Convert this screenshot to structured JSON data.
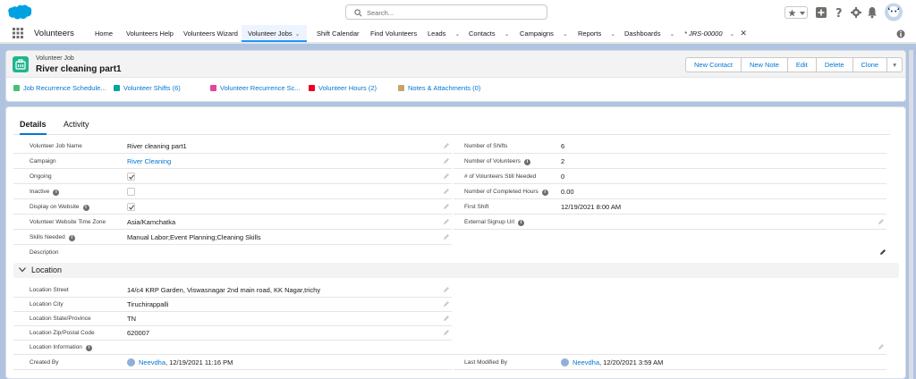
{
  "global": {
    "search_placeholder": "Search...",
    "brand_color": "#00a1e0"
  },
  "nav": {
    "app_name": "Volunteers",
    "items": [
      {
        "label": "Home"
      },
      {
        "label": "Volunteers Help"
      },
      {
        "label": "Volunteers Wizard"
      },
      {
        "label": "Volunteer Jobs"
      },
      {
        "label": "Shift Calendar"
      },
      {
        "label": "Find Volunteers"
      },
      {
        "label": "Leads"
      },
      {
        "label": "Contacts"
      },
      {
        "label": "Campaigns"
      },
      {
        "label": "Reports"
      },
      {
        "label": "Dashboards"
      },
      {
        "label": "* JRS-00000"
      }
    ]
  },
  "record": {
    "object_label": "Volunteer Job",
    "title": "River cleaning part1",
    "buttons": [
      "New Contact",
      "New Note",
      "Edit",
      "Delete",
      "Clone"
    ]
  },
  "related": [
    {
      "label": "Job Recurrence Schedule...",
      "color": "#4bc076"
    },
    {
      "label": "Volunteer Shifts (6)",
      "color": "#06a59a"
    },
    {
      "label": "Volunteer Recurrence Sc...",
      "color": "#e4449e"
    },
    {
      "label": "Volunteer Hours (2)",
      "color": "#ea001e"
    },
    {
      "label": "Notes & Attachments (0)",
      "color": "#c9a36b"
    }
  ],
  "tabs": [
    "Details",
    "Activity"
  ],
  "fields_left": [
    {
      "label": "Volunteer Job Name",
      "value": "River cleaning part1"
    },
    {
      "label": "Campaign",
      "value": "River Cleaning"
    },
    {
      "label": "Ongoing",
      "checked": true
    },
    {
      "label": "Inactive",
      "checked": false
    },
    {
      "label": "Display on Website",
      "checked": true
    },
    {
      "label": "Volunteer Website Time Zone",
      "value": "Asia/Kamchatka"
    },
    {
      "label": "Skills Needed",
      "value": "Manual Labor;Event Planning;Cleaning Skills"
    },
    {
      "label": "Description",
      "value": ""
    }
  ],
  "fields_right": [
    {
      "label": "Number of Shifts",
      "value": "6"
    },
    {
      "label": "Number of Volunteers",
      "value": "2"
    },
    {
      "label": "# of Volunteers Still Needed",
      "value": "0"
    },
    {
      "label": "Number of Completed Hours",
      "value": "0.00"
    },
    {
      "label": "First Shift",
      "value": "12/19/2021 8:00 AM"
    },
    {
      "label": "External Signup Url",
      "value": ""
    }
  ],
  "location": {
    "section_title": "Location",
    "fields": [
      {
        "label": "Location Street",
        "value": "14/c4 KRP Garden, Viswasnagar 2nd main road, KK Nagar,trichy"
      },
      {
        "label": "Location City",
        "value": "Tiruchirappalli"
      },
      {
        "label": "Location State/Province",
        "value": "TN"
      },
      {
        "label": "Location Zip/Postal Code",
        "value": "620007"
      },
      {
        "label": "Location Information",
        "value": ""
      }
    ]
  },
  "system": {
    "created_label": "Created By",
    "created_user": "Neevdha",
    "created_date": ", 12/19/2021 11:16 PM",
    "modified_label": "Last Modified By",
    "modified_user": "Neevdha",
    "modified_date": ", 12/20/2021 3:59 AM"
  }
}
